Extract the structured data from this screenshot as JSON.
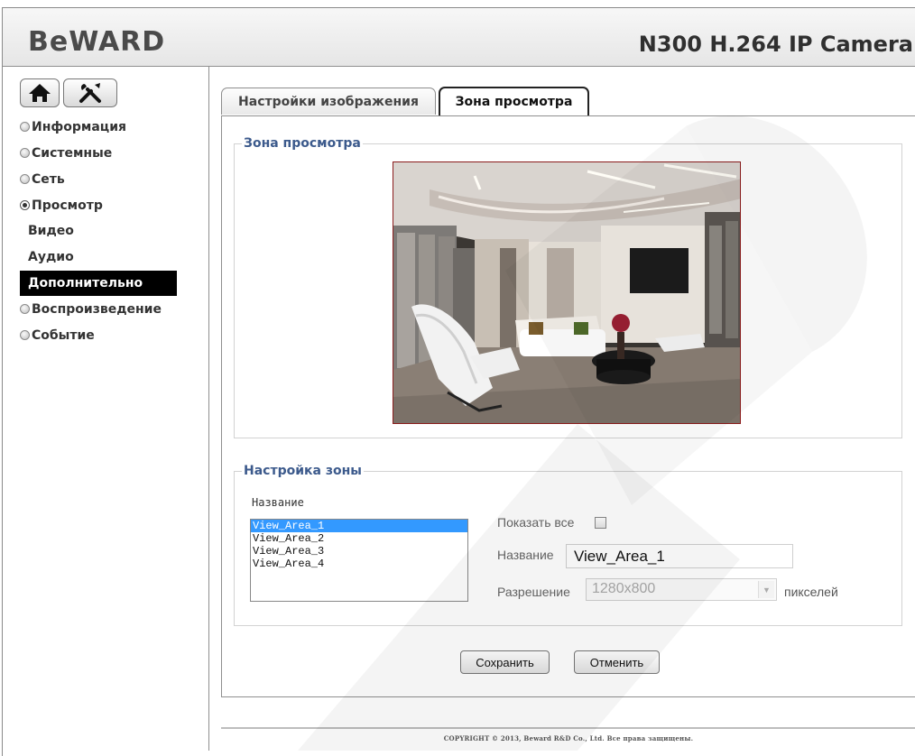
{
  "header": {
    "logo": "BeWARD",
    "title": "N300 H.264 IP Camera"
  },
  "sidebar": {
    "items": [
      {
        "label": "Информация",
        "state": "collapsed"
      },
      {
        "label": "Системные",
        "state": "collapsed"
      },
      {
        "label": "Сеть",
        "state": "collapsed"
      },
      {
        "label": "Просмотр",
        "state": "expanded"
      },
      {
        "label": "Воспроизведение",
        "state": "collapsed"
      },
      {
        "label": "Событие",
        "state": "collapsed"
      }
    ],
    "subitems": [
      {
        "label": "Видео"
      },
      {
        "label": "Аудио"
      },
      {
        "label": "Дополнительно",
        "active": true
      }
    ]
  },
  "tabs": [
    {
      "label": "Настройки изображения",
      "active": false
    },
    {
      "label": "Зона просмотра",
      "active": true
    }
  ],
  "view_area": {
    "legend": "Зона просмотра"
  },
  "zone_settings": {
    "legend": "Настройка зоны",
    "list_label": "Название",
    "list_items": [
      "View_Area_1",
      "View_Area_2",
      "View_Area_3",
      "View_Area_4"
    ],
    "selected_index": 0,
    "show_all_label": "Показать все",
    "show_all_checked": false,
    "name_label": "Название",
    "name_value": "View_Area_1",
    "resolution_label": "Разрешение",
    "resolution_value": "1280x800",
    "resolution_unit": "пикселей"
  },
  "buttons": {
    "save": "Сохранить",
    "cancel": "Отменить"
  },
  "footer": {
    "copyright": "COPYRIGHT © 2013, Beward R&D Co., Ltd. Все права защищены."
  },
  "colors": {
    "legend": "#3c5a8c",
    "selection": "#3399ff",
    "preview_border": "#8b1c1c"
  }
}
